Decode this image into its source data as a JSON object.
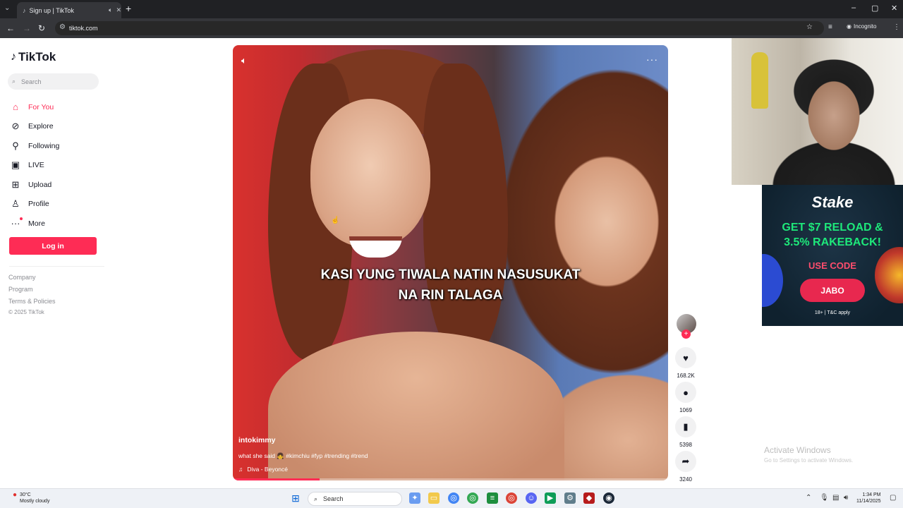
{
  "browser": {
    "tab_title": "Sign up | TikTok",
    "url": "tiktok.com",
    "incognito_label": "Incognito"
  },
  "sidebar": {
    "logo_text": "TikTok",
    "search_placeholder": "Search",
    "nav": [
      {
        "label": "For You",
        "icon": "home-icon",
        "active": true
      },
      {
        "label": "Explore",
        "icon": "compass-icon"
      },
      {
        "label": "Following",
        "icon": "following-icon"
      },
      {
        "label": "LIVE",
        "icon": "live-icon"
      },
      {
        "label": "Upload",
        "icon": "upload-icon"
      },
      {
        "label": "Profile",
        "icon": "profile-icon"
      },
      {
        "label": "More",
        "icon": "more-icon"
      }
    ],
    "login_label": "Log in",
    "footer": {
      "company": "Company",
      "program": "Program",
      "terms": "Terms & Policies",
      "copyright": "© 2025 TikTok"
    }
  },
  "video": {
    "caption_line1": "KASI YUNG TIWALA NATIN NASUSUKAT",
    "caption_line2": "NA RIN TALAGA",
    "author": "intokimmy",
    "description": "what she said 👧 #kimchiu #fyp #trending #trend",
    "music": "Diva - Beyoncé",
    "progress": 0.2
  },
  "actions": {
    "likes": "168.2K",
    "comments": "1069",
    "saves": "5398",
    "shares": "3240"
  },
  "ad": {
    "brand": "Stake",
    "headline_line1": "GET $7 RELOAD &",
    "headline_line2": "3.5% RAKEBACK!",
    "use_code": "USE CODE",
    "code": "JABO",
    "terms": "18+ | T&C apply"
  },
  "watermark": {
    "line1": "Activate Windows",
    "line2": "Go to Settings to activate Windows."
  },
  "taskbar": {
    "temp": "30°C",
    "weather": "Mostly cloudy",
    "search_label": "Search",
    "time": "1:34 PM",
    "date": "11/14/2025"
  },
  "colors": {
    "accent": "#fe2c55",
    "ad_green": "#1ee87a"
  }
}
